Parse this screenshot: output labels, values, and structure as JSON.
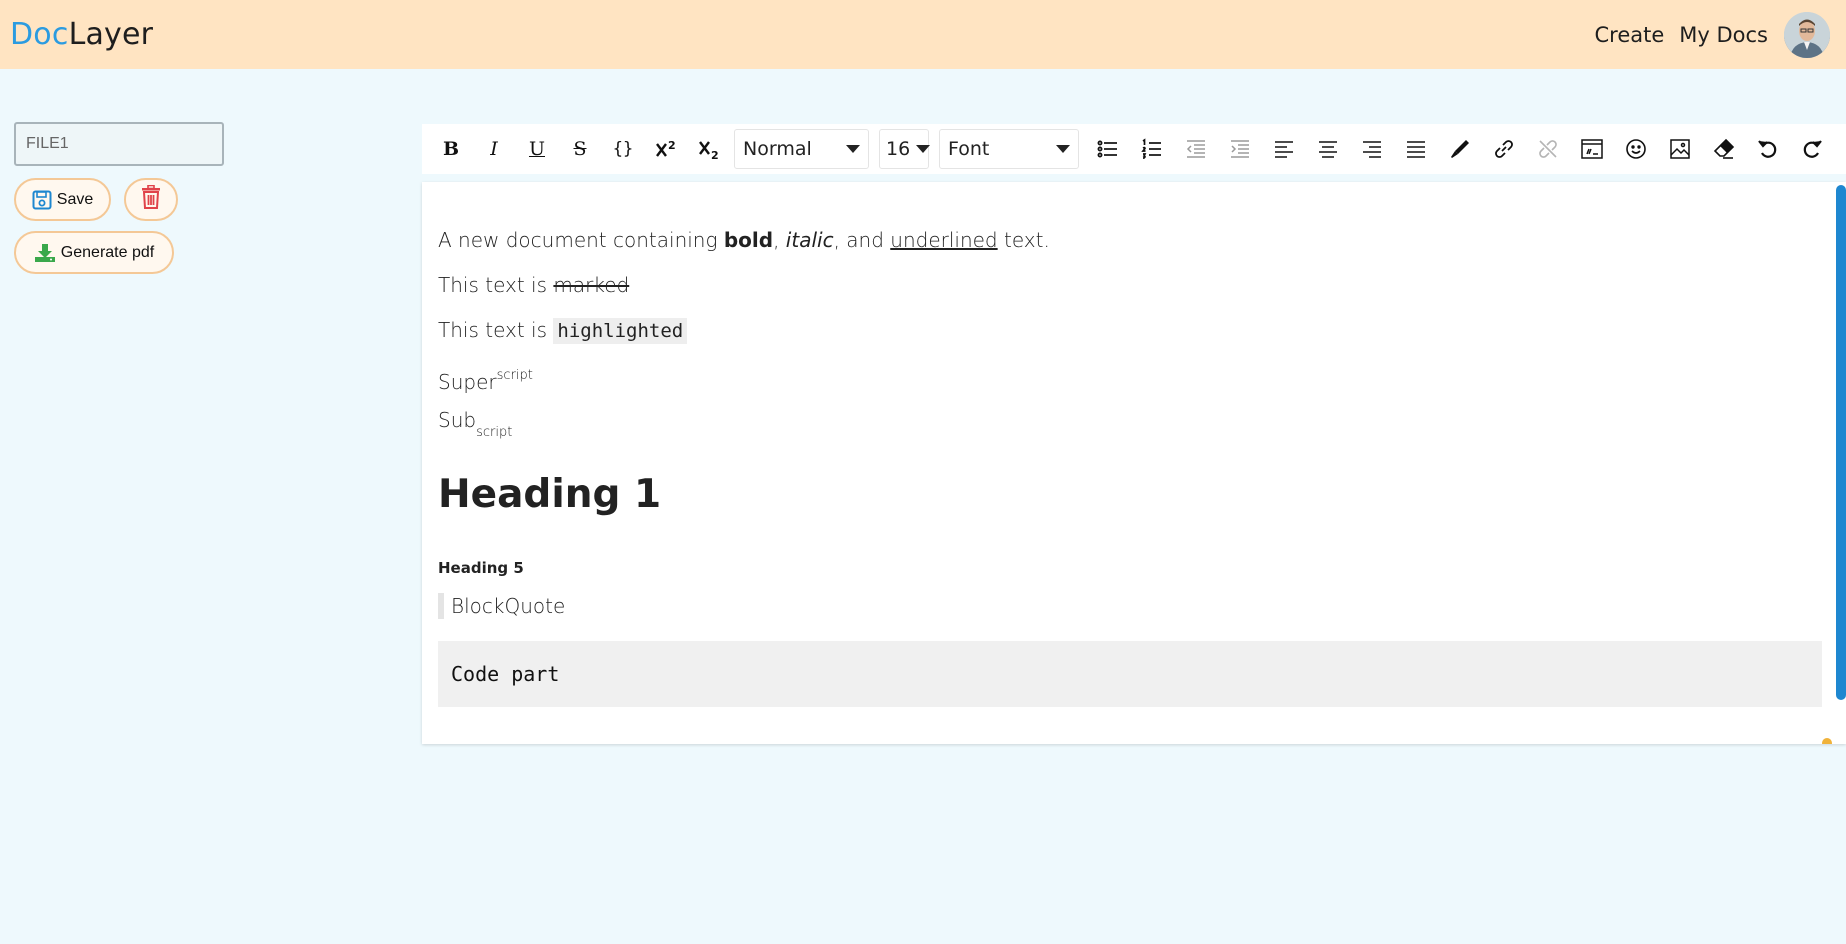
{
  "brand": {
    "part1": "Doc",
    "part2": "Layer",
    "color_part1": "#2b9be0",
    "color_part2": "#1e1e1e"
  },
  "nav": {
    "create": "Create",
    "my_docs": "My Docs"
  },
  "sidebar": {
    "file_name_value": "FILE1",
    "save_label": "Save",
    "generate_pdf_label": "Generate pdf"
  },
  "toolbar": {
    "bold": "B",
    "italic": "I",
    "underline": "U",
    "strike": "S",
    "code": "{}",
    "header_select": "Normal",
    "size_select": "16",
    "font_select": "Font",
    "icons": [
      "bold-icon",
      "italic-icon",
      "underline-icon",
      "strikethrough-icon",
      "code-icon",
      "superscript-icon",
      "subscript-icon",
      "bullet-list-icon",
      "ordered-list-icon",
      "outdent-icon",
      "indent-icon",
      "align-left-icon",
      "align-center-icon",
      "align-right-icon",
      "align-justify-icon",
      "color-picker-icon",
      "link-icon",
      "unlink-icon",
      "code-block-icon",
      "emoji-icon",
      "image-icon",
      "clear-format-icon",
      "undo-icon",
      "redo-icon"
    ]
  },
  "document": {
    "line1": {
      "prefix": "A new document containing ",
      "bold": "bold",
      "sep1": ", ",
      "italic": "italic",
      "sep2": ", and ",
      "underlined": "underlined",
      "suffix": " text."
    },
    "line2": {
      "prefix": "This text is ",
      "marked": "marked"
    },
    "line3": {
      "prefix": "This text is ",
      "highlighted": "highlighted"
    },
    "line4": {
      "base": "Super",
      "sup": "script"
    },
    "line5": {
      "base": "Sub",
      "sub": "script"
    },
    "heading1": "Heading 1",
    "heading5": "Heading 5",
    "blockquote": "BlockQuote",
    "code_block": "Code part"
  },
  "colors": {
    "header_bg": "#ffe4c2",
    "page_bg": "#eef9fd",
    "accent_blue": "#1e87d0",
    "delete_red": "#e0434a",
    "download_green": "#3aa84b",
    "pill_border": "#f4c896"
  }
}
